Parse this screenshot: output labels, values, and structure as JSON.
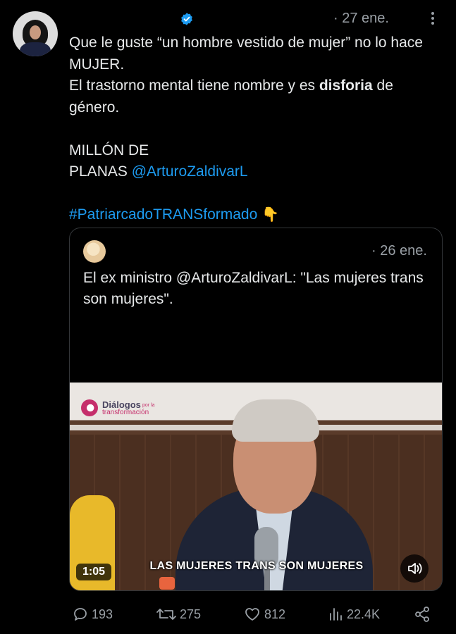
{
  "tweet": {
    "date": "· 27 ene.",
    "verified_color": "#1d9bf0",
    "text": {
      "line1": "Que le guste “un hombre vestido de mujer” no lo hace MUJER.",
      "line2_pre": "El trastorno mental tiene nombre y es ",
      "line2_bold": "disforia",
      "line2_post": " de género.",
      "line3a": "MILLÓN DE",
      "line3b_pre": "PLANAS ",
      "mention": "@ArturoZaldivarL",
      "hashtag": "#PatriarcadoTRANSformado",
      "emoji": "👇"
    }
  },
  "quote": {
    "date": "· 26 ene.",
    "text": "El ex ministro @ArturoZaldivarL: \"Las mujeres trans son mujeres\".",
    "media": {
      "logo_title": "Diálogos",
      "logo_por": "por la",
      "logo_sub": "transformación",
      "caption": "LAS MUJERES TRANS SON MUJERES",
      "duration": "1:05"
    }
  },
  "actions": {
    "replies": "193",
    "reposts": "275",
    "likes": "812",
    "views": "22.4K"
  }
}
